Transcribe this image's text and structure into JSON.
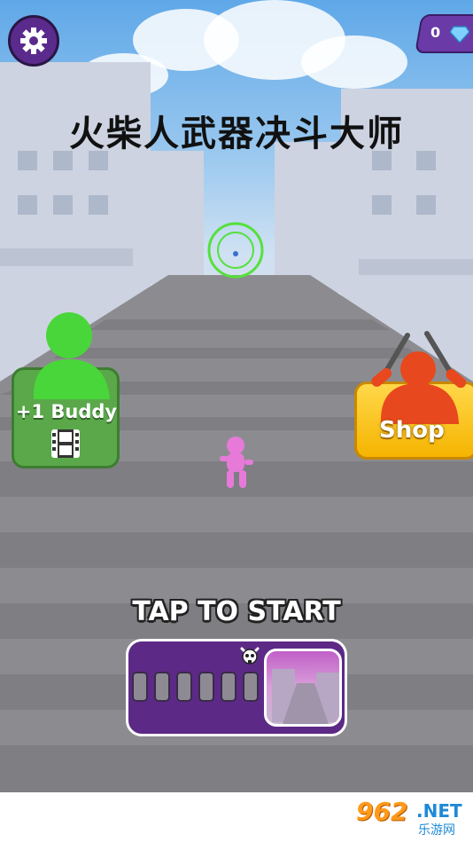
{
  "title": "火柴人武器决斗大师",
  "currency": {
    "gems": "0"
  },
  "buddy_button": {
    "label": "+1 Buddy"
  },
  "shop_button": {
    "label": "Shop"
  },
  "tap_to_start": "TAP TO START",
  "level_progress": {
    "segments_total": 6,
    "segments_filled": 0
  },
  "watermark": {
    "number": "962",
    "net": ".NET",
    "sub": "乐游网"
  },
  "colors": {
    "accent_purple": "#5c2a86",
    "buddy_green": "#5aa84a",
    "shop_yellow": "#f5b400",
    "player_pink": "#e77ad9",
    "enemy_red": "#e8481e"
  }
}
